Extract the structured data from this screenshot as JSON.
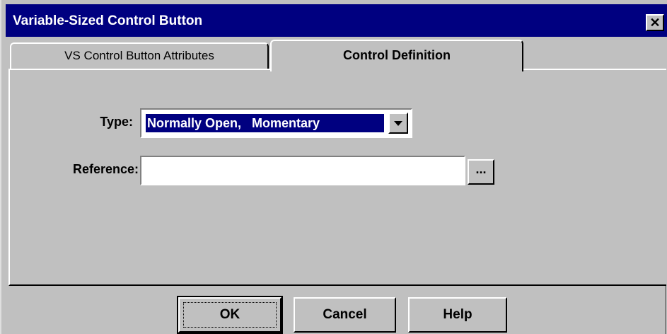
{
  "window": {
    "title": "Variable-Sized Control Button",
    "close_glyph": "✕"
  },
  "tabs": [
    {
      "label": "VS Control Button Attributes"
    },
    {
      "label": "Control Definition"
    }
  ],
  "form": {
    "type_label": "Type:",
    "type_value": "Normally Open,   Momentary",
    "reference_label": "Reference:",
    "reference_value": "",
    "browse_label": "..."
  },
  "buttons": {
    "ok": "OK",
    "cancel": "Cancel",
    "help": "Help"
  },
  "colors": {
    "titlebar": "#000080",
    "face": "#c0c0c0",
    "selection": "#000080"
  }
}
